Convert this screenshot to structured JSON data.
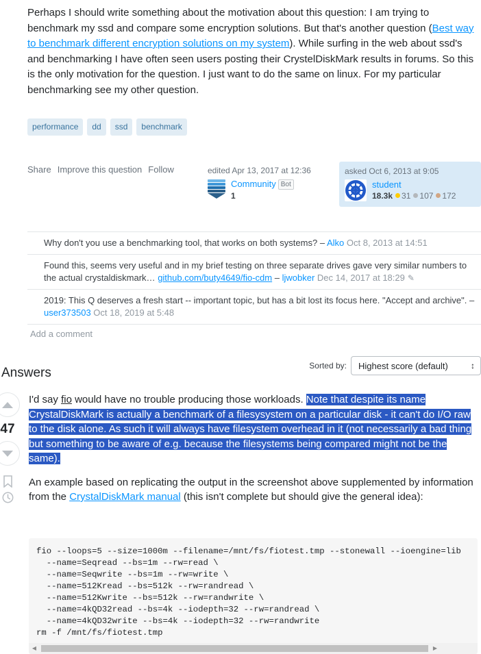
{
  "question": {
    "paragraph_runs": [
      {
        "t": "Perhaps I should write something about the motivation about this question: I am trying to benchmark my ssd and compare some encryption solutions. But that's another question (",
        "link": false
      },
      {
        "t": "Best way to benchmark different encryption solutions on my system",
        "link": true
      },
      {
        "t": "). While surfing in the web about ssd's and benchmarking I have often seen users posting their CrystelDiskMark results in forums. So this is the only motivation for the question. I just want to do the same on linux. For my particular benchmarking see my other question.",
        "link": false
      }
    ],
    "tags": [
      "performance",
      "dd",
      "ssd",
      "benchmark"
    ],
    "actions": [
      "Share",
      "Improve this question",
      "Follow"
    ],
    "edited": {
      "when": "edited Apr 13, 2017 at 12:36",
      "user": "Community",
      "badge": "Bot",
      "rep": "1",
      "avatar_icon": "community-avatar-icon"
    },
    "asked": {
      "when": "asked Oct 6, 2013 at 9:05",
      "user": "student",
      "rep": "18.3k",
      "gold": "31",
      "silver": "107",
      "bronze": "172",
      "avatar_icon": "student-avatar-icon"
    },
    "comments": [
      {
        "text": "Why don't you use a benchmarking tool, that works on both systems?",
        "link": "",
        "dash": "–",
        "user": "Alko",
        "when": "Oct 8, 2013 at 14:51",
        "pencil": false
      },
      {
        "text": "Found this, seems very useful and in my brief testing on three separate drives gave very similar numbers to the actual crystaldiskmark…",
        "link": "github.com/buty4649/fio-cdm",
        "dash": "–",
        "user": "ljwobker",
        "when": "Dec 14, 2017 at 18:29",
        "pencil": true
      },
      {
        "text": "2019: This Q deserves a fresh start -- important topic, but has a bit lost its focus here. \"Accept and archive\".",
        "link": "",
        "dash": "–",
        "user": "user373503",
        "when": "Oct 18, 2019 at 5:48",
        "pencil": false
      }
    ],
    "add_comment": "Add a comment"
  },
  "answers_section": {
    "title": "Answers",
    "sorted_by_label": "Sorted by:",
    "sorted_by_value": "Highest score (default)",
    "caret_icon": "updown-caret-icon"
  },
  "answer": {
    "vote_count": "47",
    "upvote_icon": "arrow-up-icon",
    "downvote_icon": "arrow-down-icon",
    "bookmark_icon": "bookmark-icon",
    "history_icon": "history-clock-icon",
    "p1_plain_a": "I'd say ",
    "p1_link": "fio",
    "p1_plain_b": " would have no trouble producing those workloads. ",
    "p1_selected": "Note that despite its name CrystalDiskMark is actually a benchmark of a filesysystem on a particular disk - it can't do I/O raw to the disk alone. As such it will always have filesystem overhead in it (not necessarily a bad thing but something to be aware of e.g. because the filesystems being compared might not be the same).",
    "p2_plain_a": "An example based on replicating the output in the screenshot above supplemented by information from the ",
    "p2_link": "CrystalDiskMark manual",
    "p2_plain_b": " (this isn't complete but should give the general idea):",
    "code": "fio --loops=5 --size=1000m --filename=/mnt/fs/fiotest.tmp --stonewall --ioengine=lib\n  --name=Seqread --bs=1m --rw=read \\\n  --name=Seqwrite --bs=1m --rw=write \\\n  --name=512Kread --bs=512k --rw=randread \\\n  --name=512Kwrite --bs=512k --rw=randwrite \\\n  --name=4kQD32read --bs=4k --iodepth=32 --rw=randread \\\n  --name=4kQD32write --bs=4k --iodepth=32 --rw=randwrite\nrm -f /mnt/fs/fiotest.tmp",
    "scroll_left_icon": "scroll-left-arrow-icon",
    "scroll_right_icon": "scroll-right-arrow-icon"
  },
  "colors": {
    "link": "#0a95ff",
    "tag_bg": "#e1ecf4",
    "tag_fg": "#39739d",
    "selection_bg": "#2b59c3",
    "selection_fg": "#ffffff",
    "owner_card_bg": "#d9eaf7",
    "code_bg": "#f6f6f6",
    "muted": "#6a737c"
  }
}
